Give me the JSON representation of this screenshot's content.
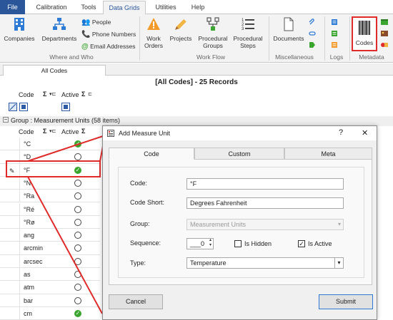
{
  "tabs": [
    "File",
    "Calibration",
    "Tools",
    "Data Grids",
    "Utilities",
    "Help"
  ],
  "ribbon": {
    "companies": "Companies",
    "departments": "Departments",
    "people": "People",
    "phone_numbers": "Phone Numbers",
    "email_addresses": "Email Addresses",
    "group_where": "Where and Who",
    "work_orders": "Work Orders",
    "projects": "Projects",
    "procedural_groups": "Procedural Groups",
    "procedural_steps": "Procedural Steps",
    "group_workflow": "Work Flow",
    "documents": "Documents",
    "group_misc": "Miscellaneous",
    "group_logs": "Logs",
    "codes": "Codes",
    "group_metadata": "Metadata",
    "highlight_color": "#e02b2b"
  },
  "grid": {
    "tab_label": "All Codes",
    "title": "[All Codes] - 25 Records",
    "col_code": "Code",
    "col_active": "Active",
    "sigma": "Σ",
    "group_label": "Group : Measurement Units (58 items)",
    "rows": [
      {
        "code": "°C",
        "active": true
      },
      {
        "code": "°D",
        "active": false
      },
      {
        "code": "°F",
        "active": true
      },
      {
        "code": "°N",
        "active": false
      },
      {
        "code": "°Ra",
        "active": false
      },
      {
        "code": "°Ré",
        "active": false
      },
      {
        "code": "°Rø",
        "active": false
      },
      {
        "code": "ang",
        "active": false
      },
      {
        "code": "arcmin",
        "active": false
      },
      {
        "code": "arcsec",
        "active": false
      },
      {
        "code": "as",
        "active": false
      },
      {
        "code": "atm",
        "active": false
      },
      {
        "code": "bar",
        "active": false
      },
      {
        "code": "cm",
        "active": true
      }
    ]
  },
  "dialog": {
    "title": "Add Measure Unit",
    "help": "?",
    "close": "✕",
    "tab_code": "Code",
    "tab_custom": "Custom",
    "tab_meta": "Meta",
    "code_label": "Code:",
    "code_value": "°F",
    "code_short_label": "Code Short:",
    "code_short_value": "Degrees Fahrenheit",
    "group_label": "Group:",
    "group_value": "Measurement Units",
    "sequence_label": "Sequence:",
    "sequence_value": "___0",
    "is_hidden_label": "Is Hidden",
    "is_active_label": "Is Active",
    "type_label": "Type:",
    "type_value": "Temperature",
    "cancel": "Cancel",
    "submit": "Submit"
  }
}
